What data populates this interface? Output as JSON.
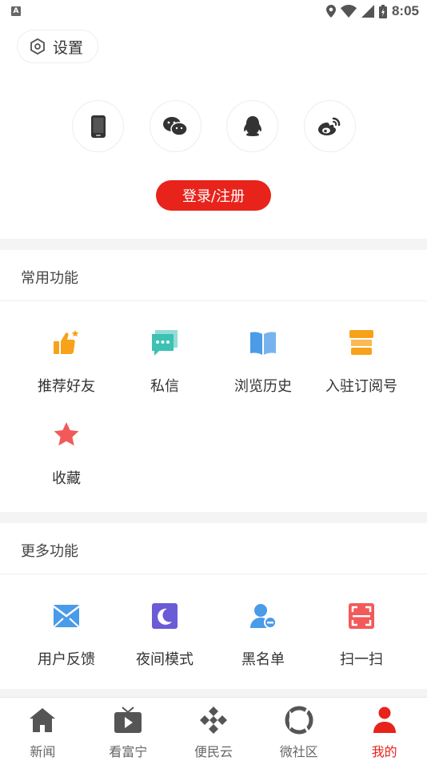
{
  "status_bar": {
    "badge": "A",
    "time": "8:05"
  },
  "settings": {
    "label": "设置"
  },
  "login": {
    "button_label": "登录/注册",
    "methods": [
      "phone-icon",
      "wechat-icon",
      "qq-icon",
      "weibo-icon"
    ]
  },
  "common": {
    "title": "常用功能",
    "items": [
      {
        "label": "推荐好友",
        "icon": "thumbs-up-icon"
      },
      {
        "label": "私信",
        "icon": "message-icon"
      },
      {
        "label": "浏览历史",
        "icon": "book-icon"
      },
      {
        "label": "入驻订阅号",
        "icon": "shop-icon"
      },
      {
        "label": "收藏",
        "icon": "star-icon"
      }
    ]
  },
  "more": {
    "title": "更多功能",
    "items": [
      {
        "label": "用户反馈",
        "icon": "mail-icon"
      },
      {
        "label": "夜间模式",
        "icon": "moon-icon"
      },
      {
        "label": "黑名单",
        "icon": "user-block-icon"
      },
      {
        "label": "扫一扫",
        "icon": "scan-icon"
      }
    ]
  },
  "nav": {
    "items": [
      {
        "label": "新闻",
        "icon": "home-icon"
      },
      {
        "label": "看富宁",
        "icon": "tv-icon"
      },
      {
        "label": "便民云",
        "icon": "diamond-grid-icon"
      },
      {
        "label": "微社区",
        "icon": "community-icon"
      },
      {
        "label": "我的",
        "icon": "person-icon",
        "active": true
      }
    ]
  },
  "colors": {
    "accent": "#e8231b",
    "orange": "#f7a21b",
    "teal": "#3cc1b4",
    "blue": "#4a9be8",
    "purple": "#6b5bd6",
    "red_light": "#f25a5a"
  }
}
